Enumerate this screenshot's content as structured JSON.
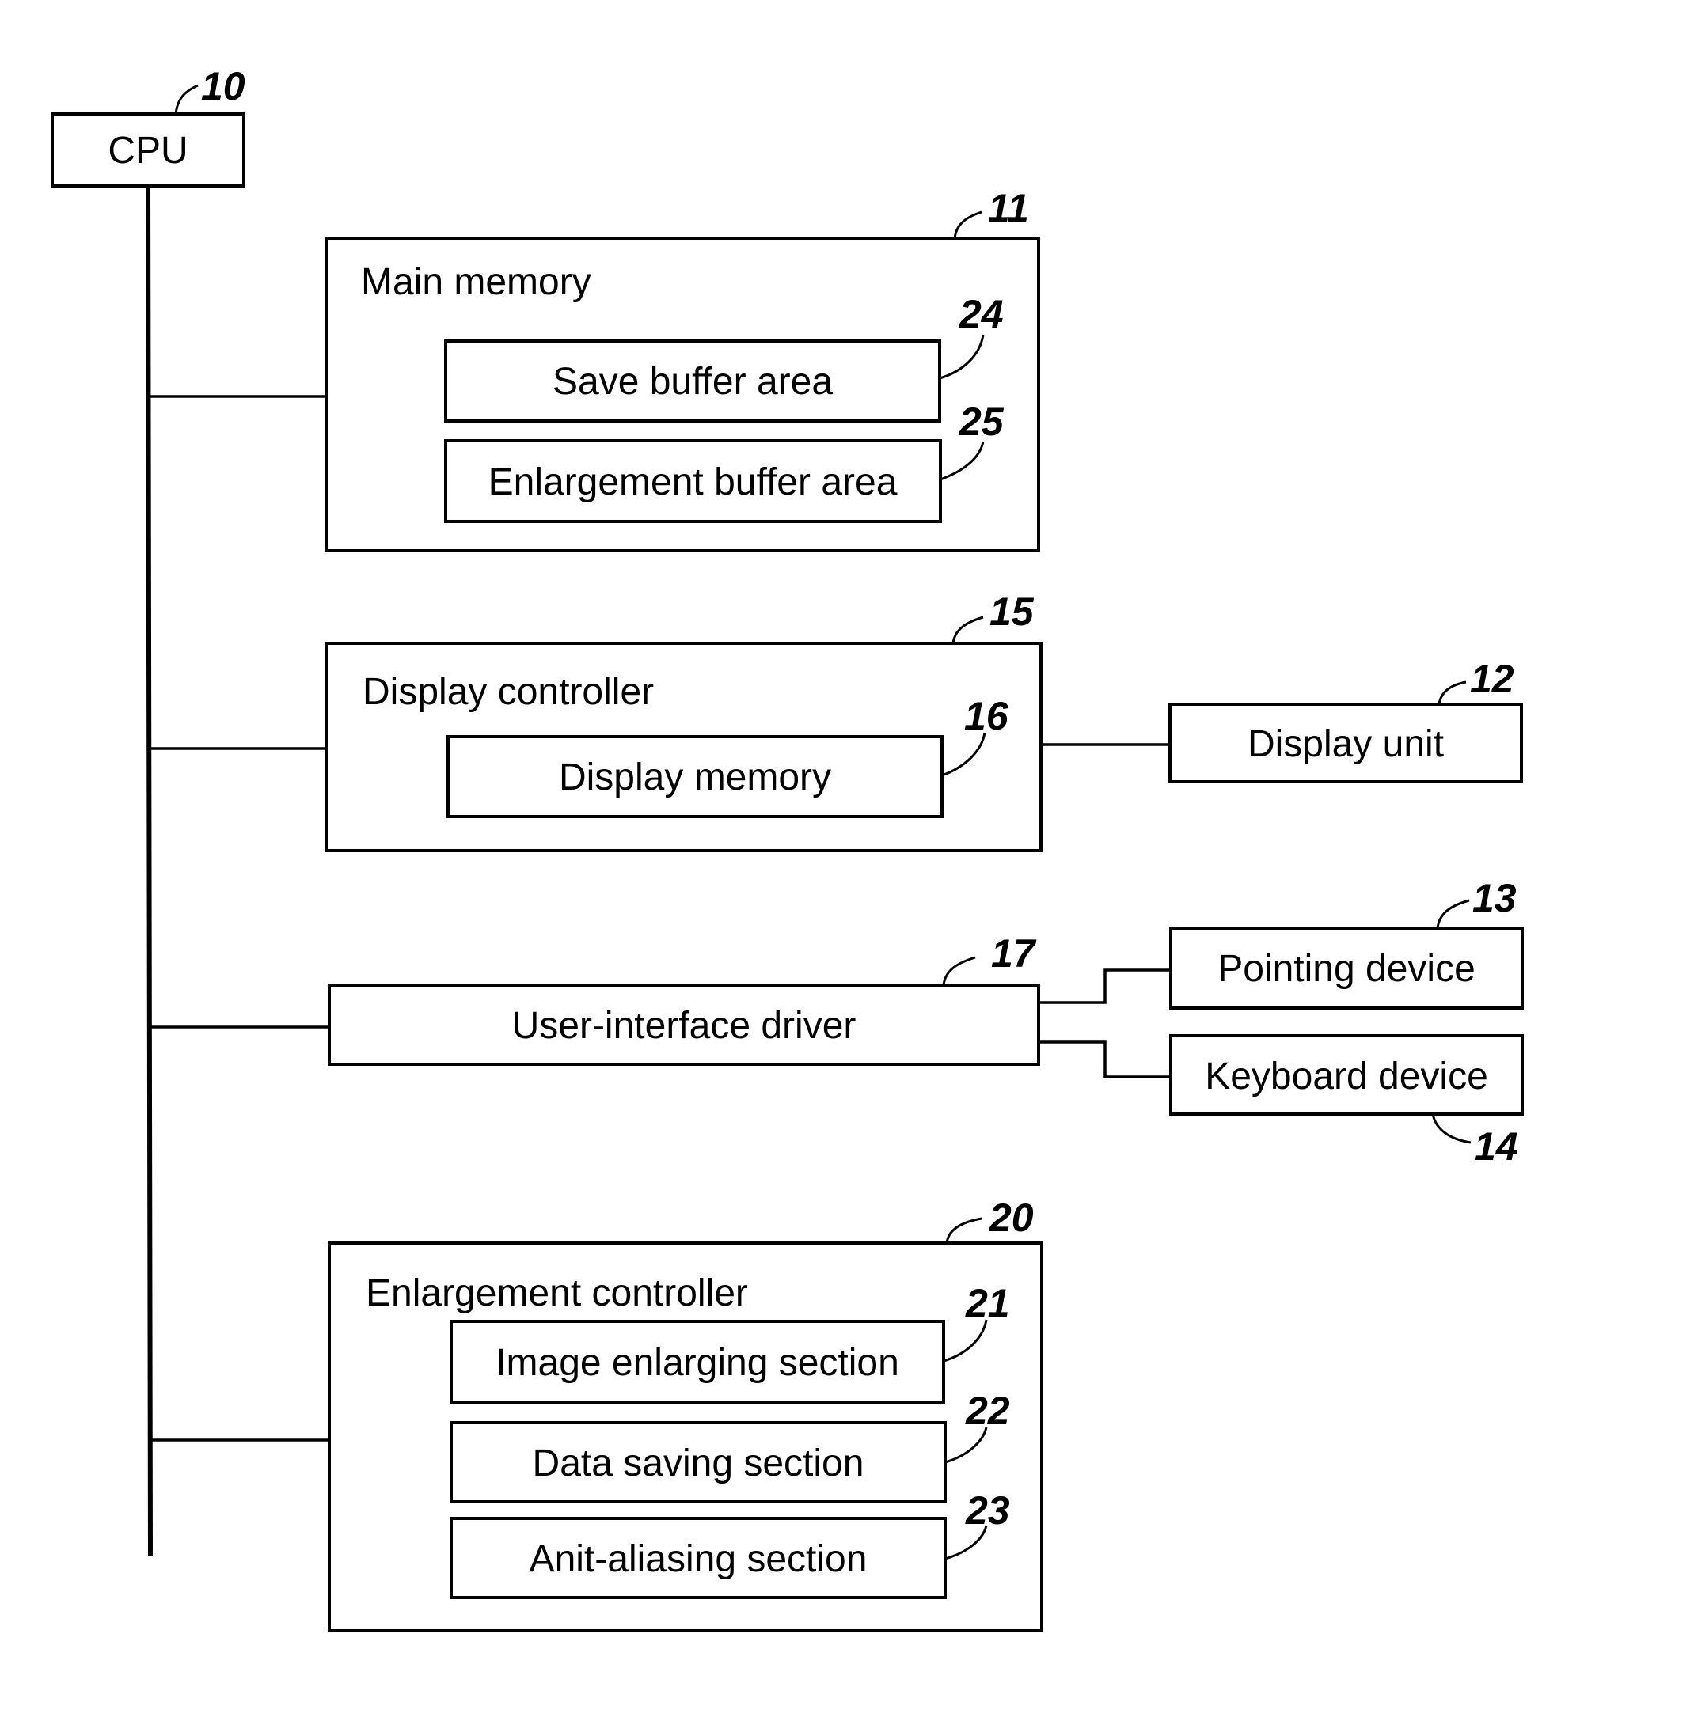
{
  "figure": {
    "cpu": {
      "label": "CPU",
      "ref": "10"
    },
    "main_memory": {
      "label": "Main memory",
      "ref": "11",
      "children": [
        {
          "label": "Save buffer area",
          "ref": "24"
        },
        {
          "label": "Enlargement buffer area",
          "ref": "25"
        }
      ]
    },
    "display_controller": {
      "label": "Display controller",
      "ref": "15",
      "children": [
        {
          "label": "Display memory",
          "ref": "16"
        }
      ]
    },
    "display_unit": {
      "label": "Display unit",
      "ref": "12"
    },
    "ui_driver": {
      "label": "User-interface driver",
      "ref": "17"
    },
    "pointing_device": {
      "label": "Pointing device",
      "ref": "13"
    },
    "keyboard_device": {
      "label": "Keyboard device",
      "ref": "14"
    },
    "enlargement_controller": {
      "label": "Enlargement controller",
      "ref": "20",
      "children": [
        {
          "label": "Image enlarging section",
          "ref": "21"
        },
        {
          "label": "Data saving section",
          "ref": "22"
        },
        {
          "label": "Anit-aliasing section",
          "ref": "23"
        }
      ]
    }
  }
}
